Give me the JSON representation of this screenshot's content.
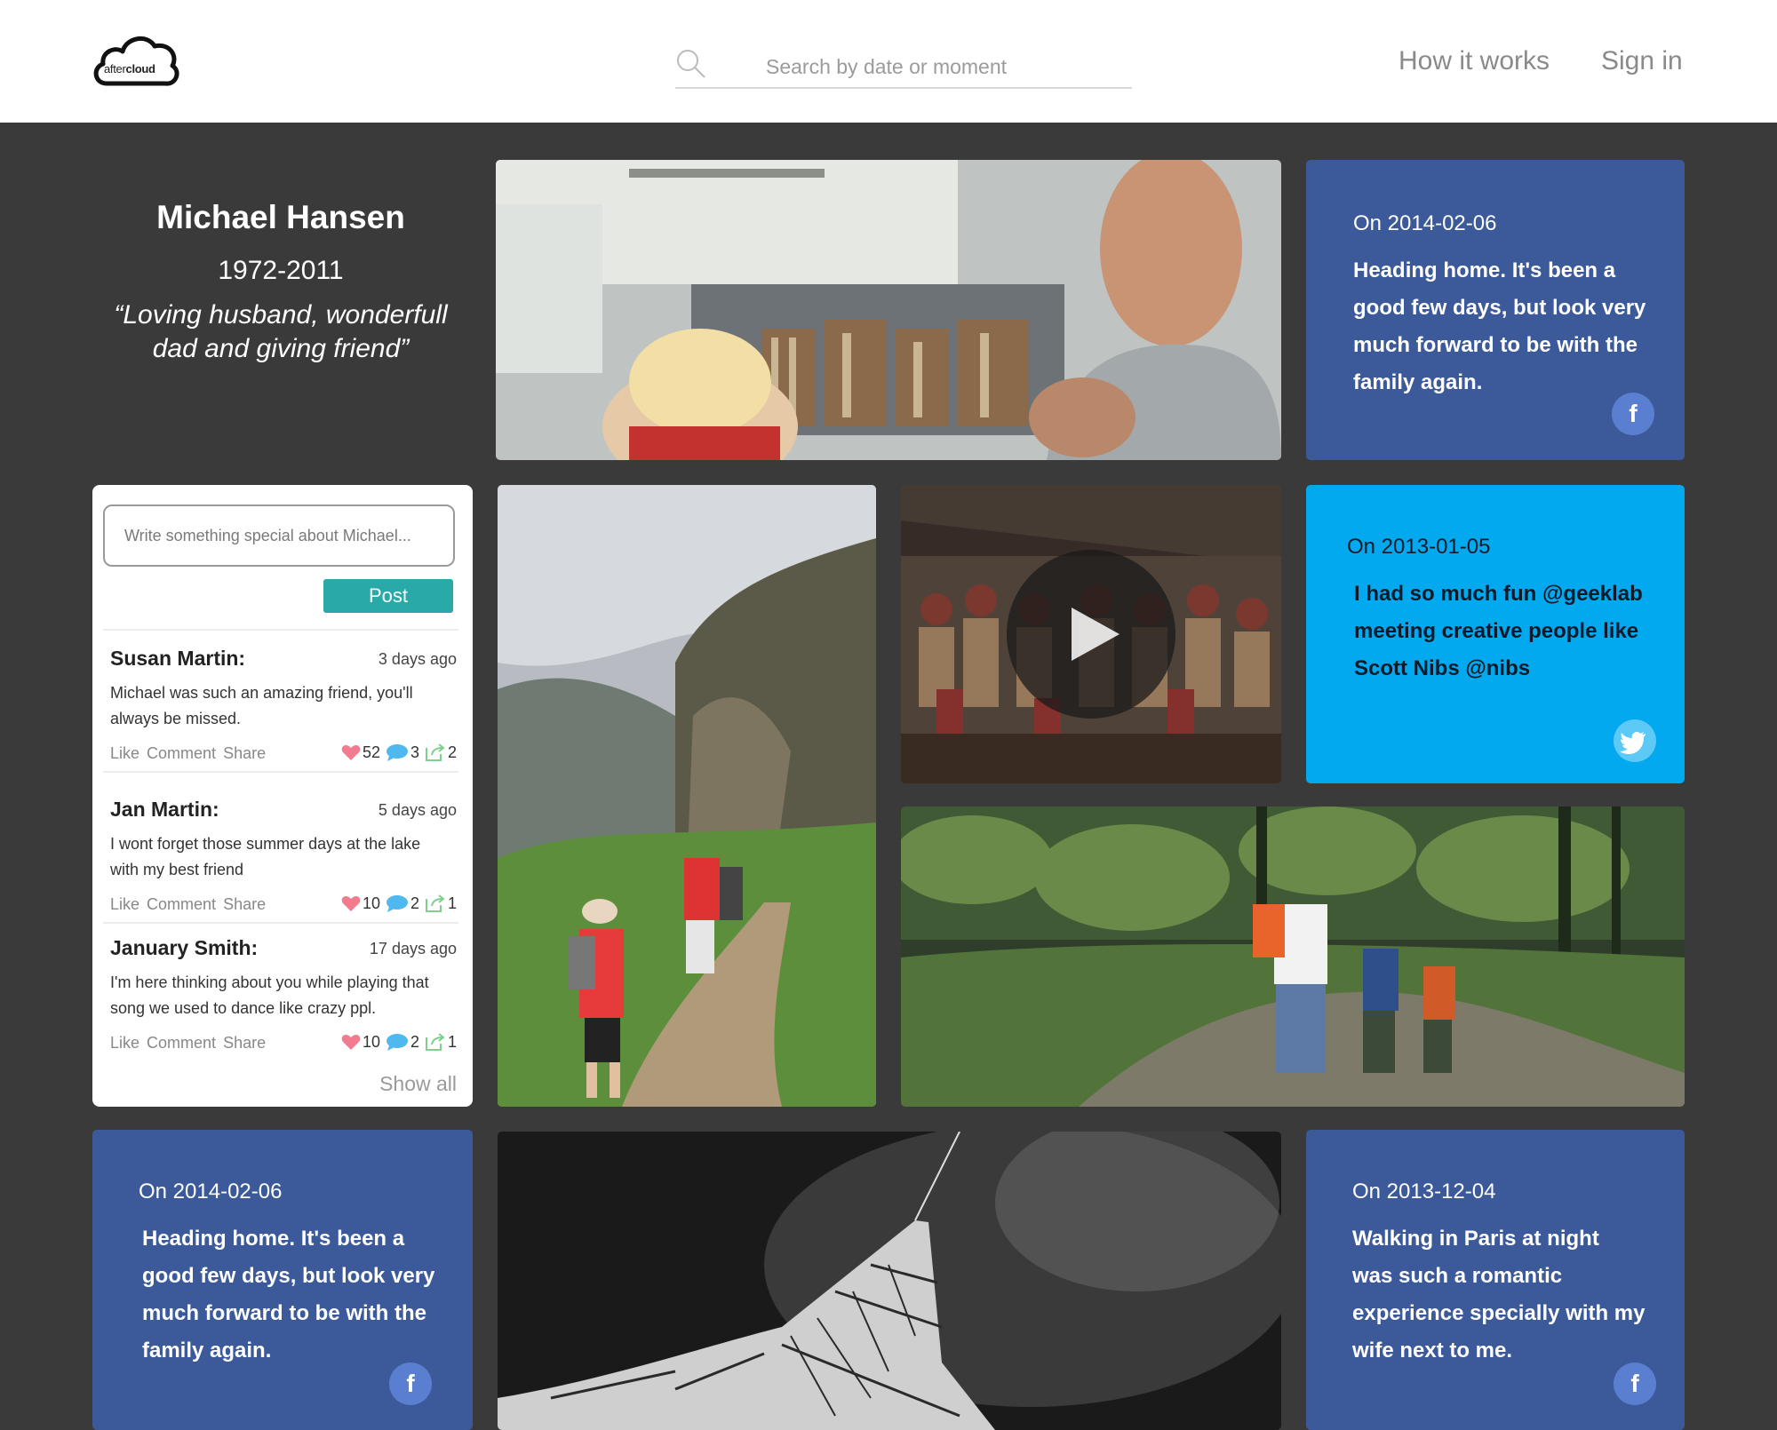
{
  "header": {
    "logo_text_light": "after",
    "logo_text_bold": "cloud",
    "search_placeholder": "Search by date or moment",
    "nav": {
      "how_it_works": "How it works",
      "sign_in": "Sign in"
    }
  },
  "profile": {
    "name": "Michael Hansen",
    "years": "1972-2011",
    "epitaph": "“Loving husband, wonderfull dad and giving friend”"
  },
  "comments_panel": {
    "input_placeholder": "Write something special about Michael...",
    "post_label": "Post",
    "show_all_label": "Show all",
    "actions": {
      "like": "Like",
      "comment": "Comment",
      "share": "Share"
    },
    "comments": [
      {
        "author": "Susan Martin:",
        "time": "3 days ago",
        "text": "Michael was such an amazing friend, you'll always be missed.",
        "likes": "52",
        "comments": "3",
        "shares": "2"
      },
      {
        "author": "Jan Martin:",
        "time": "5 days ago",
        "text": "I wont forget those summer days at the lake with my best friend",
        "likes": "10",
        "comments": "2",
        "shares": "1"
      },
      {
        "author": "January Smith:",
        "time": "17 days ago",
        "text": "I'm here thinking about you while playing that song we used to  dance like crazy ppl.",
        "likes": "10",
        "comments": "2",
        "shares": "1"
      }
    ]
  },
  "cards": {
    "fb_top": {
      "date": "On 2014-02-06",
      "text": "Heading home. It's been a\ngood few days, but look very\nmuch forward to be with the\nfamily again.",
      "badge": "f"
    },
    "tw_mid": {
      "date": "On 2013-01-05",
      "text": "I had so much fun @geeklab\nmeeting creative  people like\nScott Nibs @nibs",
      "badge": "twitter-bird"
    },
    "fb_bottom_left": {
      "date": "On 2014-02-06",
      "text": "Heading home. It's been a\ngood few days, but look very\nmuch forward to be with the\nfamily again.",
      "badge": "f"
    },
    "fb_bottom_right": {
      "date": "On 2013-12-04",
      "text": " Walking in Paris  at night\nwas such a romantic\nexperience specially with my\nwife next to me.",
      "badge": "f"
    }
  },
  "colors": {
    "page_bg": "#3a3a3a",
    "facebook_card": "#3c5a9a",
    "twitter_card": "#03a9ee",
    "post_button": "#2aa9a9",
    "like_heart": "#f27b8f",
    "comment_bubble": "#4fb8ef",
    "share_icon": "#7fcf8f"
  }
}
